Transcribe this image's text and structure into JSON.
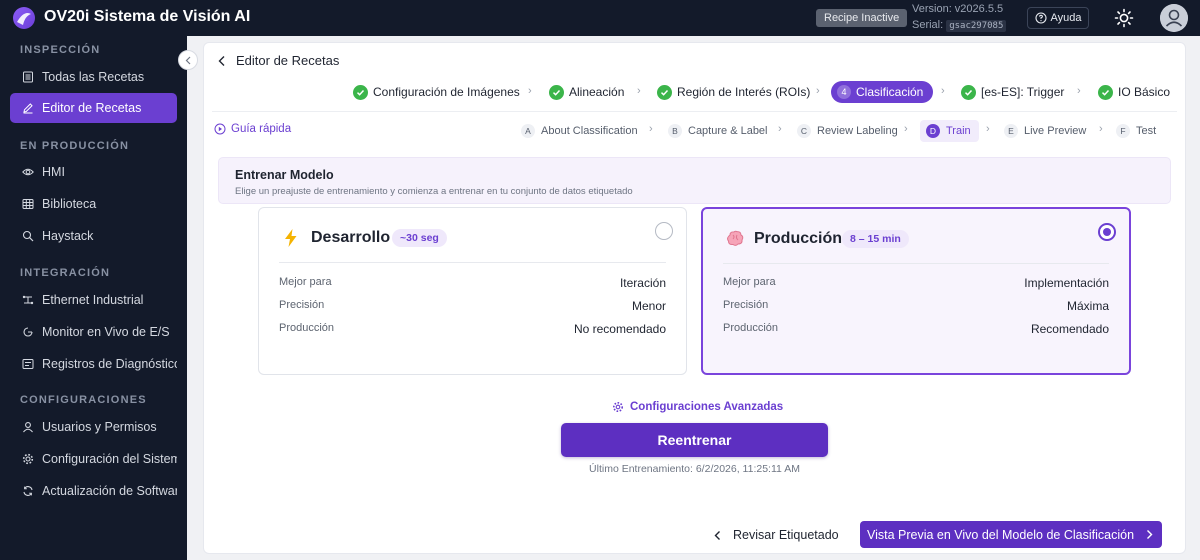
{
  "app": {
    "title": "OV20i Sistema de Visión AI",
    "recipe_status": "Recipe Inactive",
    "version": "Version: v2026.5.5",
    "serial_label": "Serial:",
    "serial_value": "gsac297085",
    "help_label": "Ayuda"
  },
  "sidebar": {
    "sections": [
      {
        "title": "INSPECCIÓN",
        "items": [
          {
            "label": "Todas las Recetas",
            "icon": "list-icon"
          },
          {
            "label": "Editor de Recetas",
            "icon": "edit-icon",
            "active": true
          }
        ]
      },
      {
        "title": "EN PRODUCCIÓN",
        "items": [
          {
            "label": "HMI",
            "icon": "eye-icon"
          },
          {
            "label": "Biblioteca",
            "icon": "grid-icon"
          },
          {
            "label": "Haystack",
            "icon": "search-icon"
          }
        ]
      },
      {
        "title": "INTEGRACIÓN",
        "items": [
          {
            "label": "Ethernet Industrial",
            "icon": "network-icon"
          },
          {
            "label": "Monitor en Vivo de E/S",
            "icon": "monitor-icon"
          },
          {
            "label": "Registros de Diagnóstico",
            "icon": "log-icon"
          }
        ]
      },
      {
        "title": "CONFIGURACIONES",
        "items": [
          {
            "label": "Usuarios y Permisos",
            "icon": "user-icon"
          },
          {
            "label": "Configuración del Sistema",
            "icon": "gear-icon"
          },
          {
            "label": "Actualización de Software",
            "icon": "refresh-icon"
          }
        ]
      }
    ]
  },
  "main": {
    "back_label": "Editor de Recetas",
    "steps": [
      {
        "label": "Configuración de Imágenes",
        "status": "done"
      },
      {
        "label": "Alineación",
        "status": "done"
      },
      {
        "label": "Región de Interés (ROIs)",
        "status": "done"
      },
      {
        "label": "Clasificación",
        "status": "current",
        "number": "4"
      },
      {
        "label": "[es-ES]: Trigger",
        "status": "done"
      },
      {
        "label": "IO Básico",
        "status": "done"
      }
    ],
    "guide_label": "Guía rápida",
    "substeps": [
      {
        "letter": "A",
        "label": "About Classification"
      },
      {
        "letter": "B",
        "label": "Capture & Label"
      },
      {
        "letter": "C",
        "label": "Review Labeling"
      },
      {
        "letter": "D",
        "label": "Train",
        "current": true
      },
      {
        "letter": "E",
        "label": "Live Preview"
      },
      {
        "letter": "F",
        "label": "Test"
      }
    ],
    "train": {
      "title": "Entrenar Modelo",
      "description": "Elige un preajuste de entrenamiento y comienza a entrenar en tu conjunto de datos etiquetado"
    },
    "options": [
      {
        "title": "Desarrollo",
        "badge": "~30 seg",
        "icon": "lightning-icon",
        "selected": false,
        "rows": [
          {
            "k": "Mejor para",
            "v": "Iteración"
          },
          {
            "k": "Precisión",
            "v": "Menor"
          },
          {
            "k": "Producción",
            "v": "No recomendado"
          }
        ]
      },
      {
        "title": "Producción",
        "badge": "8 – 15 min",
        "icon": "brain-icon",
        "selected": true,
        "rows": [
          {
            "k": "Mejor para",
            "v": "Implementación"
          },
          {
            "k": "Precisión",
            "v": "Máxima"
          },
          {
            "k": "Producción",
            "v": "Recomendado"
          }
        ]
      }
    ],
    "advanced_label": "Configuraciones Avanzadas",
    "retrain_label": "Reentrenar",
    "last_trained": "Último Entrenamiento: 6/2/2026, 11:25:11 AM",
    "review_label": "Revisar Etiquetado",
    "preview_label": "Vista Previa en Vivo del Modelo de Clasificación"
  },
  "colors": {
    "accent": "#6b3fd1",
    "sidebar_bg": "#131a2a",
    "success": "#3bb54a"
  }
}
